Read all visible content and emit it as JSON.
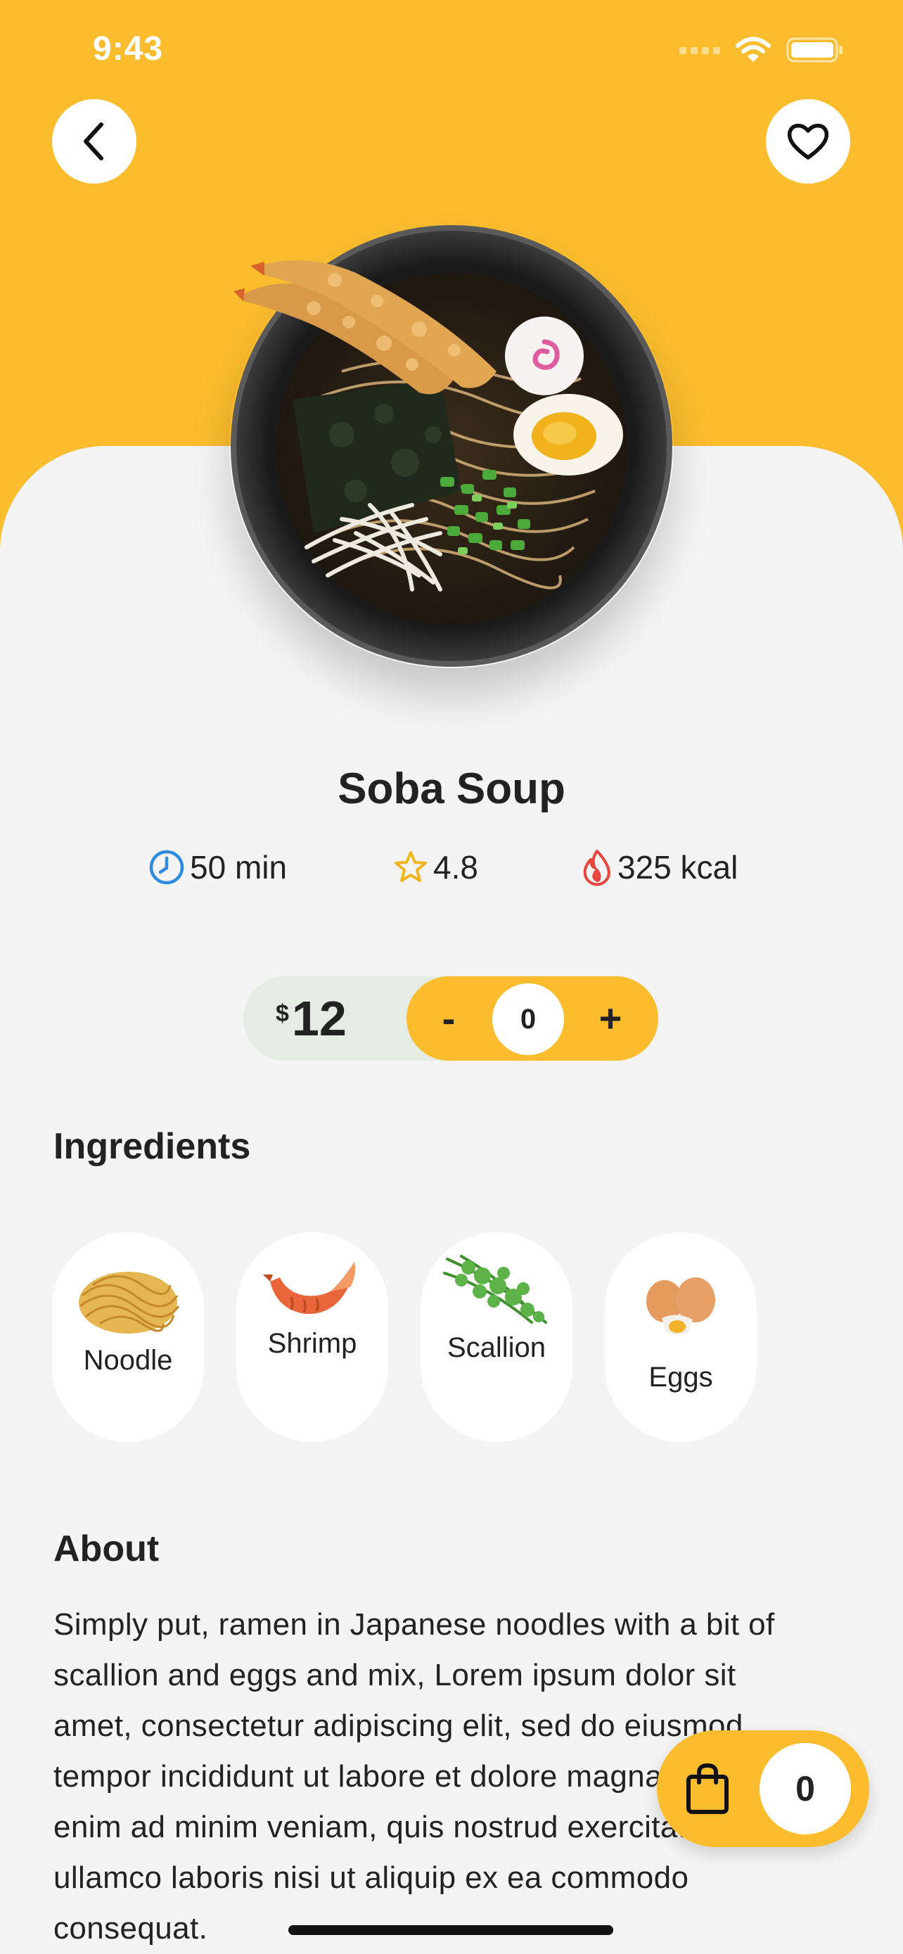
{
  "status_bar": {
    "time": "9:43"
  },
  "header": {
    "back_icon": "chevron-left-icon",
    "favorite_icon": "heart-icon"
  },
  "dish": {
    "name": "Soba Soup",
    "time": "50 min",
    "rating": "4.8",
    "calories": "325 kcal",
    "currency": "$",
    "price": "12"
  },
  "quantity": {
    "minus": "-",
    "value": "0",
    "plus": "+"
  },
  "ingredients": {
    "title": "Ingredients",
    "items": [
      {
        "label": "Noodle"
      },
      {
        "label": "Shrimp"
      },
      {
        "label": "Scallion"
      },
      {
        "label": "Eggs"
      }
    ]
  },
  "about": {
    "title": "About",
    "text": "Simply put, ramen in Japanese noodles with a bit of scallion and eggs and mix, Lorem ipsum dolor sit amet, consectetur adipiscing elit, sed do eiusmod tempor incididunt ut labore et dolore magna aliqua. Ut enim ad minim veniam, quis nostrud exercitation ullamco laboris nisi ut aliquip ex ea commodo consequat."
  },
  "cart": {
    "icon": "shopping-bag-icon",
    "count": "0"
  },
  "colors": {
    "accent": "#fbbd2e",
    "background": "#f4f4f4",
    "price_pill": "#e5ece3",
    "clock": "#2f8be0",
    "star": "#f2b51f",
    "fire": "#e8453c"
  }
}
